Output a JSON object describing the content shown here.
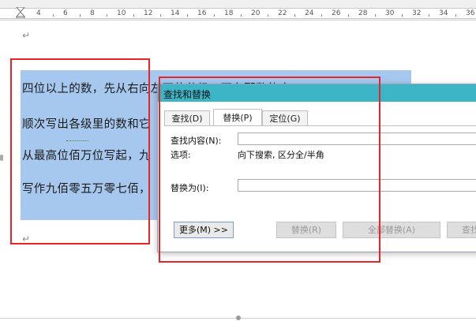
{
  "ruler": {
    "numbers": [
      "4",
      "6",
      "8",
      "10",
      "12",
      "14",
      "16",
      "18",
      "20",
      "22",
      "24",
      "26",
      "28",
      "30",
      "32",
      "34",
      "36"
    ]
  },
  "document": {
    "paragraph_mark": "↵",
    "lines": [
      "四位以上的数，先从右向左四位分级，再在那数的中",
      "顺次写出各级里的数和它",
      "从最高位佰万位写起，九",
      "写作九佰零五万零七佰，"
    ]
  },
  "dialog": {
    "title": "查找和替换",
    "tabs": [
      {
        "label": "查找(D)",
        "active": false
      },
      {
        "label": "替换(P)",
        "active": true
      },
      {
        "label": "定位(G)",
        "active": false
      }
    ],
    "find_label": "查找内容(N):",
    "find_value": "",
    "options_label": "选项:",
    "options_value": "向下搜索, 区分全/半角",
    "replace_label": "替换为(I):",
    "replace_value": "",
    "buttons": {
      "more": "更多(M) >>",
      "replace": "替换(R)",
      "replace_all": "全部替换(A)",
      "find_next": "查找"
    }
  },
  "colors": {
    "titlebar": "#3cb6c6",
    "selection": "#a7c8ee",
    "annotation": "#e8232a"
  }
}
